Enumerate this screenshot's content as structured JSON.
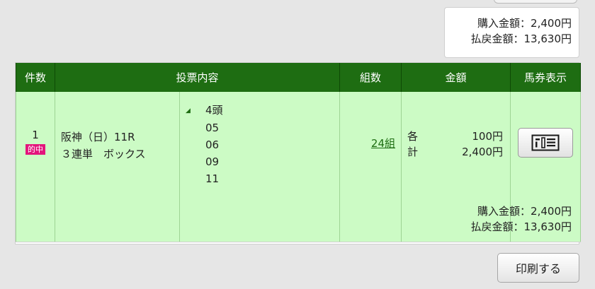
{
  "summary_top": {
    "purchase_label": "購入金額：",
    "purchase_value": "2,400円",
    "refund_label": "払戻金額：",
    "refund_value": "13,630円"
  },
  "table": {
    "headers": [
      "件数",
      "投票内容",
      "組数",
      "金額",
      "馬券表示"
    ],
    "row": {
      "number": "1",
      "hit_badge": "的中",
      "race": "阪神（日）11R",
      "bet_type": "３連単　ボックス",
      "head_count": "4頭",
      "picks": [
        "05",
        "06",
        "09",
        "11"
      ],
      "sets": "24組",
      "each_label": "各",
      "each_value": "100円",
      "total_label": "計",
      "total_value": "2,400円",
      "ticket_icon": "ticket-view-icon"
    }
  },
  "summary_bottom": {
    "purchase_label": "購入金額：",
    "purchase_value": "2,400円",
    "refund_label": "払戻金額：",
    "refund_value": "13,630円"
  },
  "print_button": "印刷する",
  "colors": {
    "header_green": "#1e6d12",
    "row_green": "#ccfbc5",
    "hit_pink": "#e3157c"
  }
}
